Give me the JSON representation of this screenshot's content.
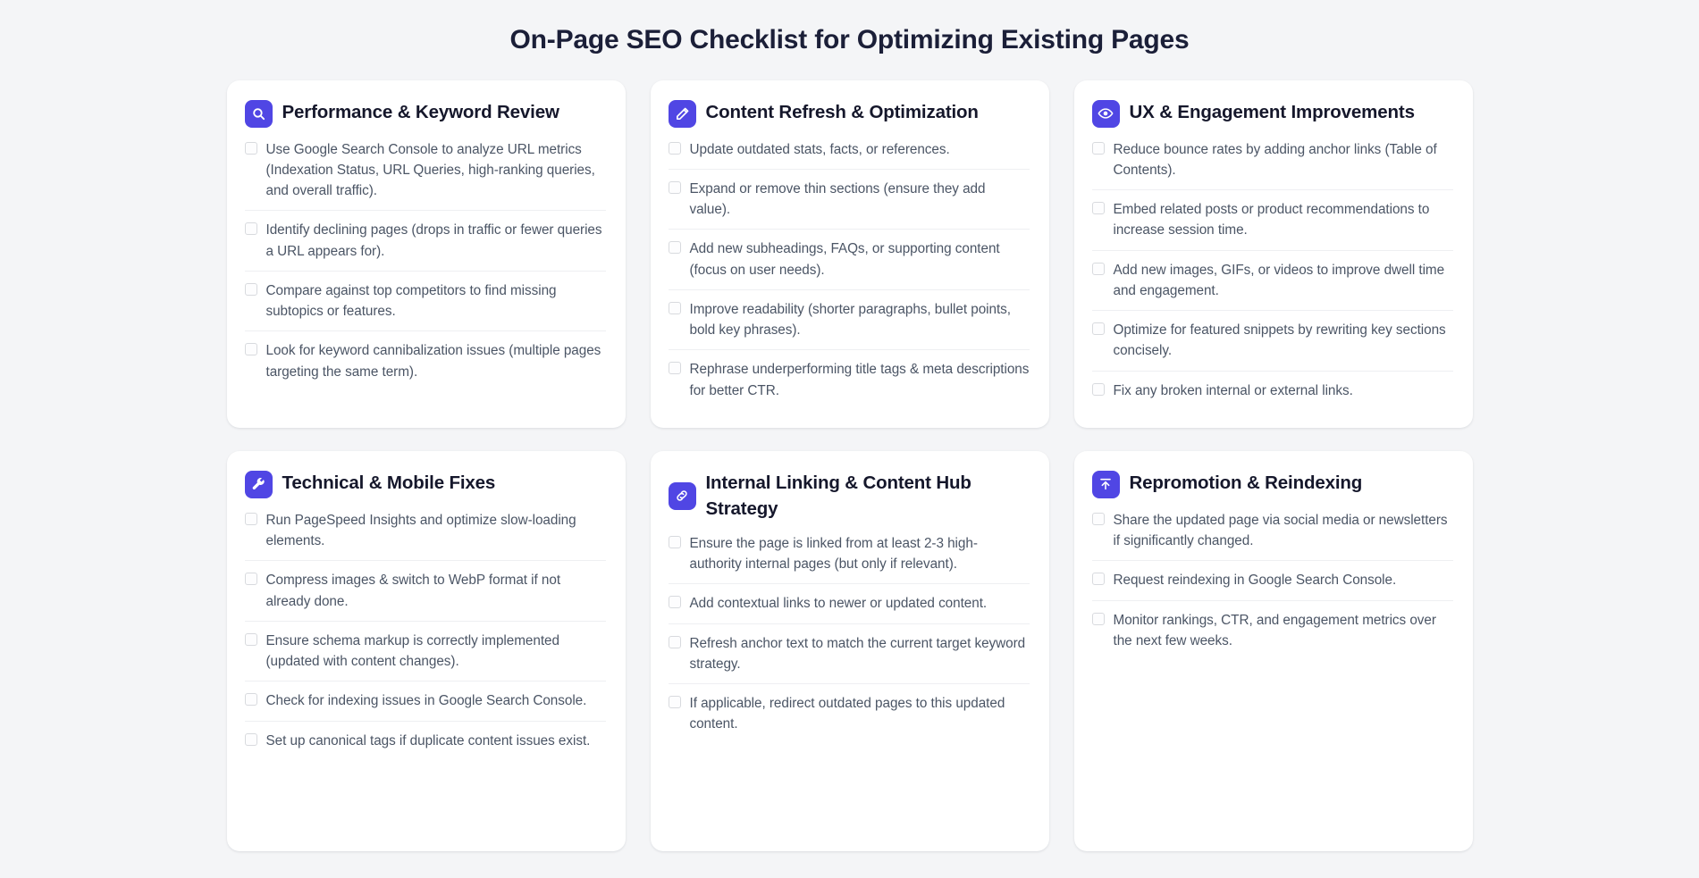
{
  "header": {
    "title": "On-Page SEO Checklist for Optimizing Existing Pages"
  },
  "theme": {
    "accent": "#5046e4",
    "page_background": "#f4f5f7",
    "card_background": "#ffffff",
    "title_color": "#15172b",
    "item_text_color": "#4b5565",
    "divider_color": "#eeeff2",
    "checkbox_border": "#d8dade"
  },
  "cards": [
    {
      "icon": "search-icon",
      "title": "Performance & Keyword Review",
      "items": [
        "Use Google Search Console to analyze URL metrics (Indexation Status, URL Queries, high-ranking queries, and overall traffic).",
        "Identify declining pages (drops in traffic or fewer queries a URL appears for).",
        "Compare against top competitors to find missing subtopics or features.",
        "Look for keyword cannibalization issues (multiple pages targeting the same term)."
      ]
    },
    {
      "icon": "pencil-icon",
      "title": "Content Refresh & Optimization",
      "items": [
        "Update outdated stats, facts, or references.",
        "Expand or remove thin sections (ensure they add value).",
        "Add new subheadings, FAQs, or supporting content (focus on user needs).",
        "Improve readability (shorter paragraphs, bullet points, bold key phrases).",
        "Rephrase underperforming title tags & meta descriptions for better CTR."
      ]
    },
    {
      "icon": "eye-icon",
      "title": "UX & Engagement Improvements",
      "items": [
        "Reduce bounce rates by adding anchor links (Table of Contents).",
        "Embed related posts or product recommendations to increase session time.",
        "Add new images, GIFs, or videos to improve dwell time and engagement.",
        "Optimize for featured snippets by rewriting key sections concisely.",
        "Fix any broken internal or external links."
      ]
    },
    {
      "icon": "wrench-icon",
      "title": "Technical & Mobile Fixes",
      "items": [
        "Run PageSpeed Insights and optimize slow-loading elements.",
        "Compress images & switch to WebP format if not already done.",
        "Ensure schema markup is correctly implemented (updated with content changes).",
        "Check for indexing issues in Google Search Console.",
        "Set up canonical tags if duplicate content issues exist."
      ]
    },
    {
      "icon": "link-icon",
      "title": "Internal Linking & Content Hub Strategy",
      "items": [
        "Ensure the page is linked from at least 2-3 high-authority internal pages (but only if relevant).",
        "Add contextual links to newer or updated content.",
        "Refresh anchor text to match the current target keyword strategy.",
        "If applicable, redirect outdated pages to this updated content."
      ]
    },
    {
      "icon": "upload-icon",
      "title": "Repromotion & Reindexing",
      "items": [
        "Share the updated page via social media or newsletters if significantly changed.",
        "Request reindexing in Google Search Console.",
        "Monitor rankings, CTR, and engagement metrics over the next few weeks."
      ]
    }
  ]
}
